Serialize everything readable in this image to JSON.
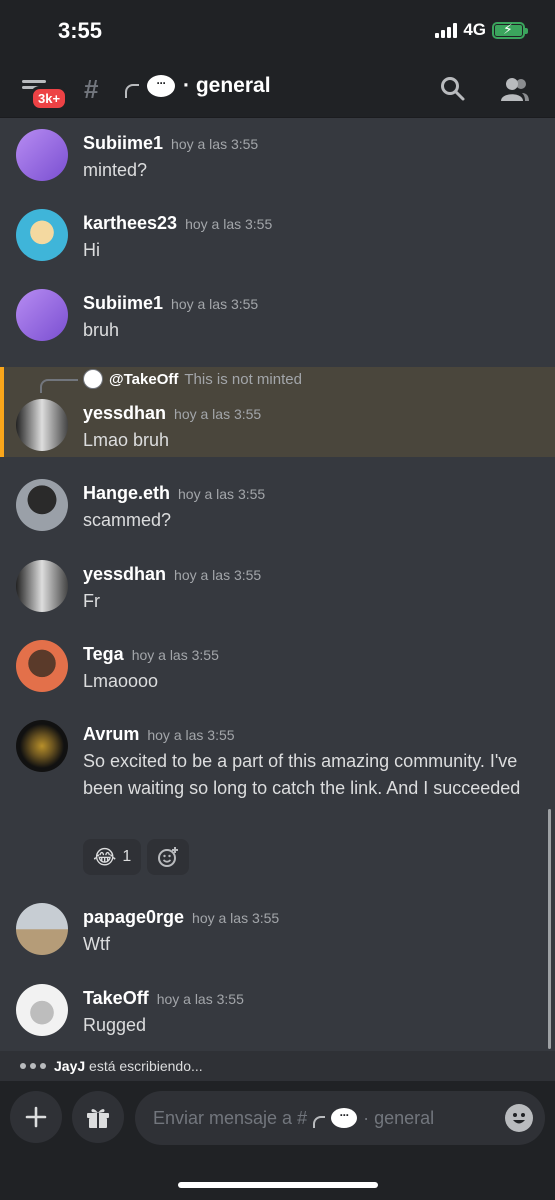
{
  "status": {
    "time": "3:55",
    "network": "4G"
  },
  "header": {
    "badge": "3k+",
    "channel": "general"
  },
  "messages": [
    {
      "author": "Subiime1",
      "time": "hoy a las 3:55",
      "text": "minted?"
    },
    {
      "author": "karthees23",
      "time": "hoy a las 3:55",
      "text": "Hi"
    },
    {
      "author": "Subiime1",
      "time": "hoy a las 3:55",
      "text": "bruh"
    },
    {
      "author": "yessdhan",
      "time": "hoy a las 3:55",
      "text": "Lmao bruh"
    },
    {
      "author": "Hange.eth",
      "time": "hoy a las 3:55",
      "text": "scammed?"
    },
    {
      "author": "yessdhan",
      "time": "hoy a las 3:55",
      "text": "Fr"
    },
    {
      "author": "Tega",
      "time": "hoy a las 3:55",
      "text": "Lmaoooo"
    },
    {
      "author": "Avrum",
      "time": "hoy a las 3:55",
      "text": "So excited to be a part of this amazing community. I've been waiting so long to catch the link.  And I succeeded"
    },
    {
      "author": "papage0rge",
      "time": "hoy a las 3:55",
      "text": "Wtf"
    },
    {
      "author": "TakeOff",
      "time": "hoy a las 3:55",
      "text": "Rugged"
    }
  ],
  "reply": {
    "name": "@TakeOff",
    "text": "This is not minted"
  },
  "reaction": {
    "emoji": "😂",
    "count": "1"
  },
  "typing": {
    "user": "JayJ",
    "suffix": "está escribiendo..."
  },
  "input": {
    "prefix": "Enviar mensaje a #",
    "channel": "general"
  },
  "colors": {
    "highlight": "#4a463c",
    "mention_bar": "#faa61a",
    "badge": "#ed4245",
    "battery": "#3ba55d"
  }
}
